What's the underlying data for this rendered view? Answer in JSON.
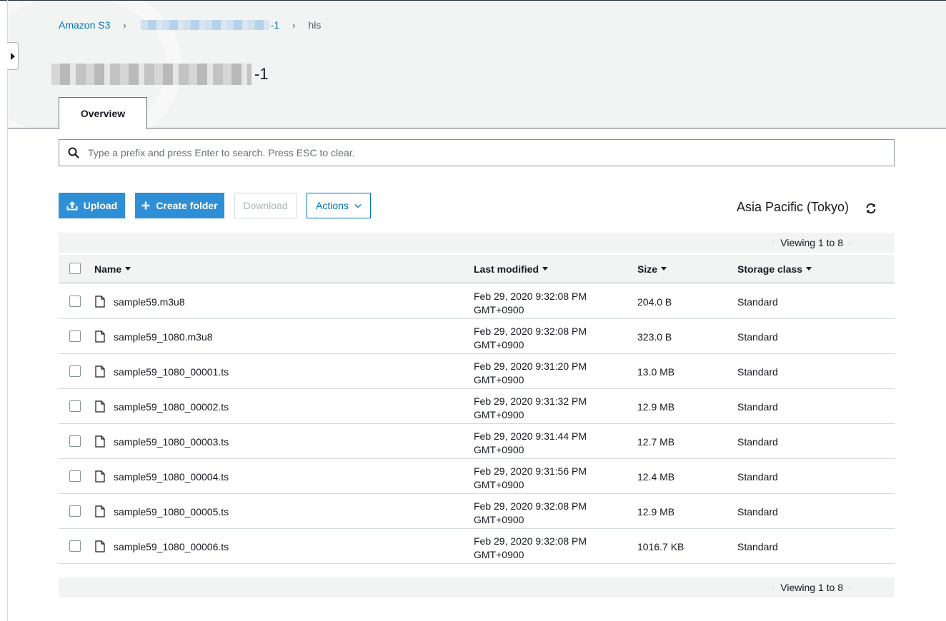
{
  "breadcrumb": {
    "root": "Amazon S3",
    "bucket_suffix": "-1",
    "current": "hls"
  },
  "bucket": {
    "title_suffix": "-1"
  },
  "tabs": [
    {
      "label": "Overview"
    }
  ],
  "search": {
    "placeholder": "Type a prefix and press Enter to search. Press ESC to clear.",
    "value": ""
  },
  "toolbar": {
    "upload": "Upload",
    "create_folder": "Create folder",
    "download": "Download",
    "actions": "Actions"
  },
  "region": "Asia Pacific (Tokyo)",
  "viewing": "Viewing 1 to 8",
  "table": {
    "headers": {
      "name": "Name",
      "modified": "Last modified",
      "size": "Size",
      "storage": "Storage class"
    },
    "rows": [
      {
        "name": "sample59.m3u8",
        "modified_date": "Feb 29, 2020 9:32:08 PM",
        "modified_tz": "GMT+0900",
        "size": "204.0 B",
        "storage": "Standard"
      },
      {
        "name": "sample59_1080.m3u8",
        "modified_date": "Feb 29, 2020 9:32:08 PM",
        "modified_tz": "GMT+0900",
        "size": "323.0 B",
        "storage": "Standard"
      },
      {
        "name": "sample59_1080_00001.ts",
        "modified_date": "Feb 29, 2020 9:31:20 PM",
        "modified_tz": "GMT+0900",
        "size": "13.0 MB",
        "storage": "Standard"
      },
      {
        "name": "sample59_1080_00002.ts",
        "modified_date": "Feb 29, 2020 9:31:32 PM",
        "modified_tz": "GMT+0900",
        "size": "12.9 MB",
        "storage": "Standard"
      },
      {
        "name": "sample59_1080_00003.ts",
        "modified_date": "Feb 29, 2020 9:31:44 PM",
        "modified_tz": "GMT+0900",
        "size": "12.7 MB",
        "storage": "Standard"
      },
      {
        "name": "sample59_1080_00004.ts",
        "modified_date": "Feb 29, 2020 9:31:56 PM",
        "modified_tz": "GMT+0900",
        "size": "12.4 MB",
        "storage": "Standard"
      },
      {
        "name": "sample59_1080_00005.ts",
        "modified_date": "Feb 29, 2020 9:32:08 PM",
        "modified_tz": "GMT+0900",
        "size": "12.9 MB",
        "storage": "Standard"
      },
      {
        "name": "sample59_1080_00006.ts",
        "modified_date": "Feb 29, 2020 9:32:08 PM",
        "modified_tz": "GMT+0900",
        "size": "1016.7 KB",
        "storage": "Standard"
      }
    ]
  },
  "colors": {
    "primary": "#2e8fd6",
    "link": "#0073bb",
    "header_bg": "#f2f3f3"
  }
}
